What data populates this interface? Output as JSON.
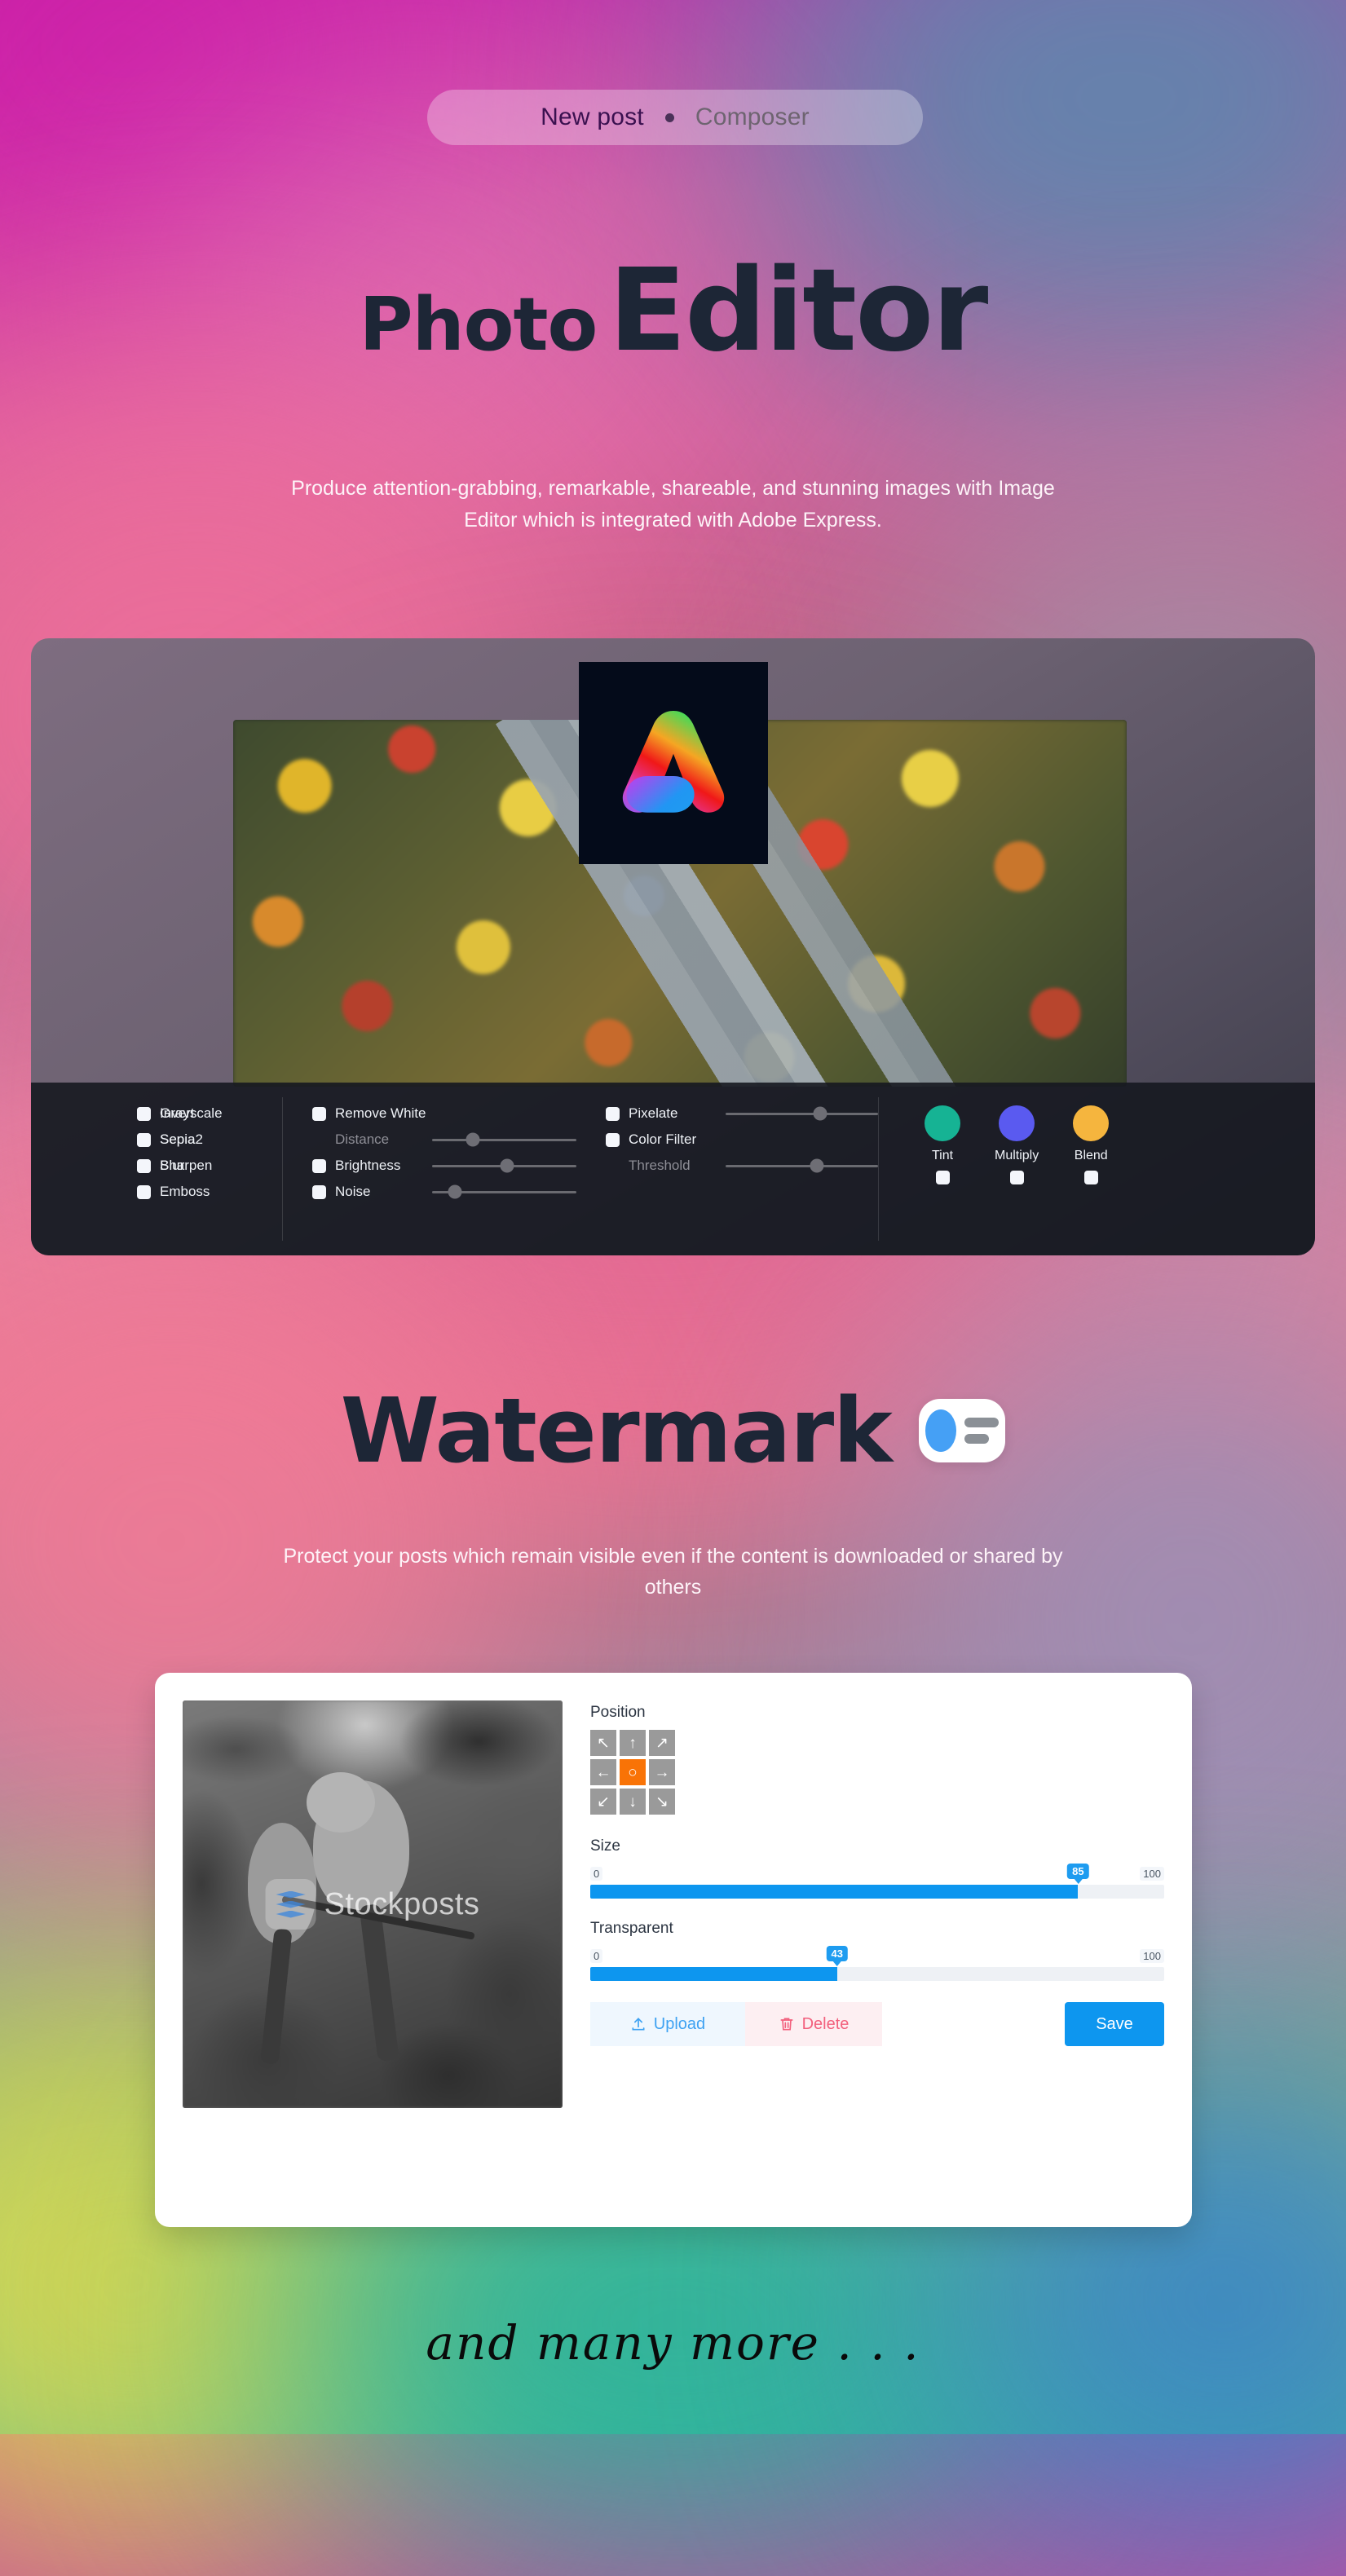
{
  "badge": {
    "left_label": "New post",
    "separator_icon": "dot-icon",
    "right_label": "Composer"
  },
  "hero": {
    "title_part1": "Photo",
    "title_part2": "Editor",
    "subtitle": "Produce attention-grabbing, remarkable, shareable, and stunning images with Image Editor which is integrated with Adobe Express."
  },
  "editor": {
    "brand_logo_name": "adobe-express-logo",
    "filters_col1": [
      {
        "label": "Grayscale",
        "checked": false
      },
      {
        "label": "Sepia",
        "checked": false
      },
      {
        "label": "Blur",
        "checked": false
      },
      {
        "label": "Emboss",
        "checked": false
      }
    ],
    "filters_col2": [
      {
        "label": "Invert",
        "checked": false
      },
      {
        "label": "Sepia2",
        "checked": false
      },
      {
        "label": "Sharpen",
        "checked": false
      }
    ],
    "filters_col3": [
      {
        "label": "Remove White",
        "checked": false
      },
      {
        "label": "Brightness",
        "checked": false
      },
      {
        "label": "Noise",
        "checked": false
      }
    ],
    "sliders_col3": [
      {
        "label": "Distance",
        "value": 28,
        "dim": true
      },
      {
        "label": "Brightness",
        "value": 52,
        "dim": false
      },
      {
        "label": "Noise",
        "value": 16,
        "dim": false
      }
    ],
    "filters_col4": [
      {
        "label": "Pixelate",
        "checked": false
      },
      {
        "label": "Color Filter",
        "checked": false
      }
    ],
    "sliders_col4": [
      {
        "label": "Pixelate",
        "value": 62,
        "dim": false
      },
      {
        "label": "Threshold",
        "value": 60,
        "dim": true
      }
    ],
    "swatches": [
      {
        "label": "Tint",
        "color": "#16b394",
        "checked": false
      },
      {
        "label": "Multiply",
        "color": "#5a5af0",
        "checked": false
      },
      {
        "label": "Blend",
        "color": "#f5b53e",
        "checked": false
      }
    ]
  },
  "watermark": {
    "title": "Watermark",
    "icon_name": "watermark-toggle-icon",
    "subtitle": "Protect your posts which remain visible even if the content is downloaded or shared by others",
    "preview_watermark_text": "Stockposts",
    "position": {
      "label": "Position",
      "cells": [
        {
          "name": "arrow-up-left",
          "glyph": "↖",
          "active": false
        },
        {
          "name": "arrow-up",
          "glyph": "↑",
          "active": false
        },
        {
          "name": "arrow-up-right",
          "glyph": "↗",
          "active": false
        },
        {
          "name": "arrow-left",
          "glyph": "←",
          "active": false
        },
        {
          "name": "center",
          "glyph": "○",
          "active": true
        },
        {
          "name": "arrow-right",
          "glyph": "→",
          "active": false
        },
        {
          "name": "arrow-down-left",
          "glyph": "↙",
          "active": false
        },
        {
          "name": "arrow-down",
          "glyph": "↓",
          "active": false
        },
        {
          "name": "arrow-down-right",
          "glyph": "↘",
          "active": false
        }
      ]
    },
    "size": {
      "label": "Size",
      "min": "0",
      "max": "100",
      "value": "85"
    },
    "transparent": {
      "label": "Transparent",
      "min": "0",
      "max": "100",
      "value": "43"
    },
    "buttons": {
      "upload": "Upload",
      "delete": "Delete",
      "save": "Save"
    }
  },
  "footer": {
    "text": "and many more . . ."
  }
}
